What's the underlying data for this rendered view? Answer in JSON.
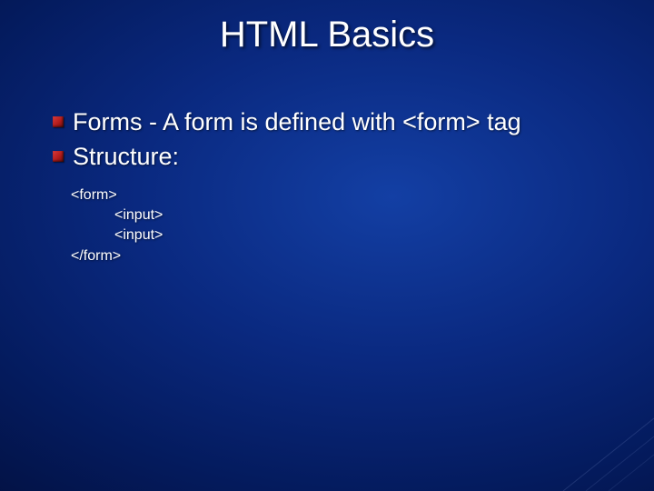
{
  "title": "HTML Basics",
  "bullets": [
    "Forms - A form is defined with <form> tag",
    "Structure:"
  ],
  "code": {
    "line1": "<form>",
    "line2": "<input>",
    "line3": "<input>",
    "line4": "</form>"
  }
}
